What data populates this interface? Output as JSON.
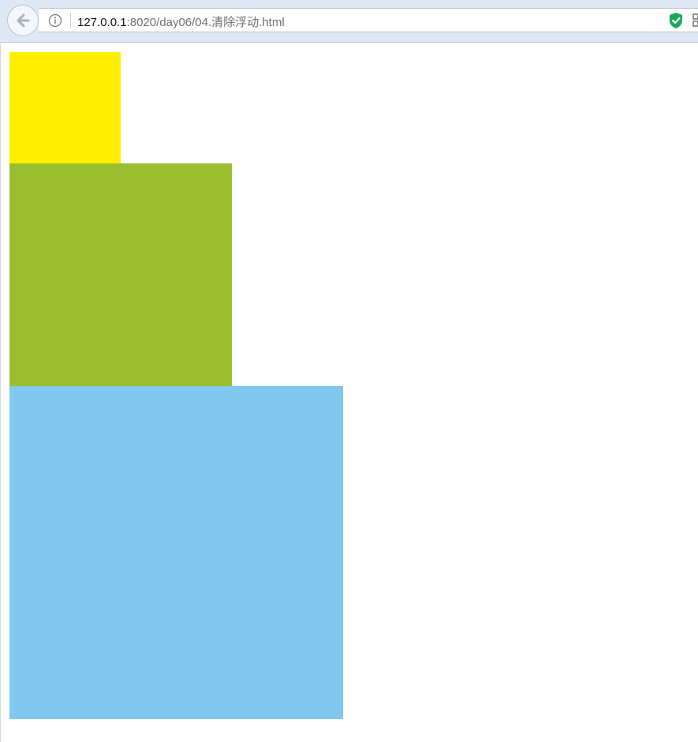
{
  "browser": {
    "address_bar": {
      "url_host": "127.0.0.1",
      "url_rest": ":8020/day06/04.清除浮动.html"
    },
    "icons": {
      "back": "back-arrow-icon",
      "info": "info-icon",
      "security": "shield-check-icon",
      "extension": "extension-icon"
    }
  },
  "page": {
    "boxes": [
      {
        "name": "yellow-box",
        "color": "#ffee00"
      },
      {
        "name": "green-box",
        "color": "#9abe2e"
      },
      {
        "name": "blue-box",
        "color": "#80c8ee"
      }
    ]
  }
}
